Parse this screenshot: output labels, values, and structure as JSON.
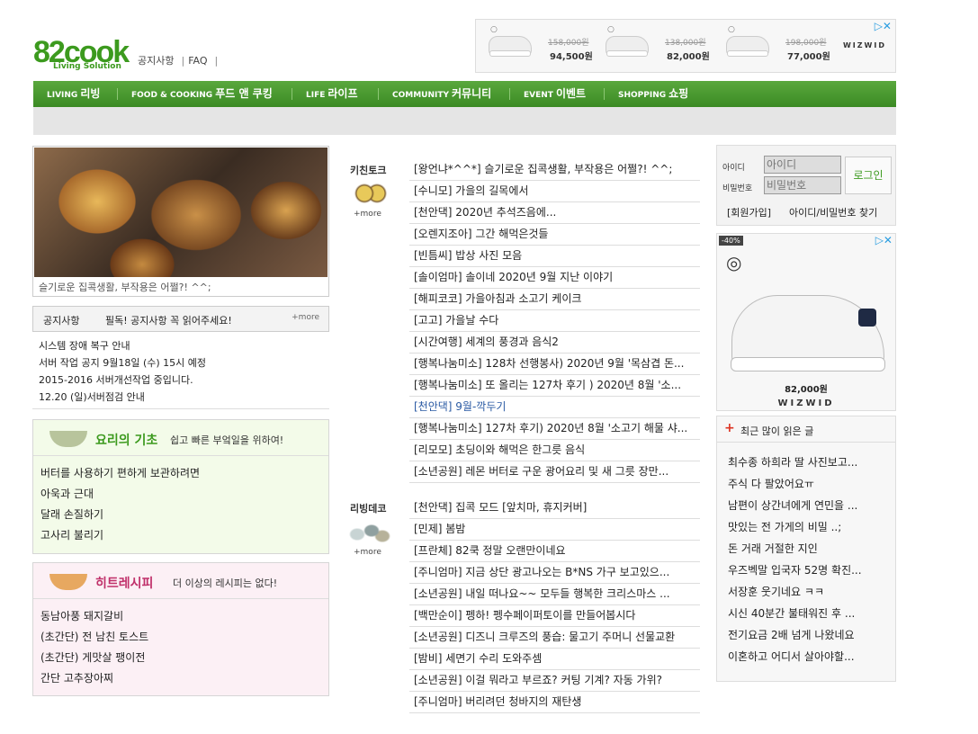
{
  "header": {
    "logo_main": "82cook",
    "logo_sub": "Living Solution",
    "links": [
      "공지사항",
      "FAQ"
    ]
  },
  "top_ad": {
    "items": [
      {
        "old_price": "158,000원",
        "new_price": "94,500원"
      },
      {
        "old_price": "138,000원",
        "new_price": "82,000원"
      },
      {
        "old_price": "198,000원",
        "new_price": "77,000원"
      }
    ],
    "brand": "WIZWID"
  },
  "nav": [
    {
      "en": "LIVING",
      "ko": "리빙"
    },
    {
      "en": "FOOD & COOKING",
      "ko": "푸드 앤 쿠킹"
    },
    {
      "en": "LIFE",
      "ko": "라이프"
    },
    {
      "en": "COMMUNITY",
      "ko": "커뮤니티"
    },
    {
      "en": "EVENT",
      "ko": "이벤트"
    },
    {
      "en": "SHOPPING",
      "ko": "쇼핑"
    }
  ],
  "feature": {
    "caption": "슬기로운 집콕생활, 부작용은 어쩔?! ^^;"
  },
  "notice": {
    "title": "공지사항",
    "message": "필독! 공지사항 꼭 읽어주세요!",
    "more": "+more",
    "items": [
      "시스템 장애 복구 안내",
      "서버 작업 공지 9월18일 (수) 15시 예정",
      "2015-2016 서버개선작업 중입니다.",
      "12.20 (일)서버점검 안내"
    ]
  },
  "basics": {
    "title": "요리의 기초",
    "subtitle": "쉽고 빠른 부엌일을 위하여!",
    "items": [
      "버터를 사용하기 편하게 보관하려면",
      "아욱과 근대",
      "달래 손질하기",
      "고사리 불리기"
    ],
    "color": "#3c9a1e"
  },
  "hits": {
    "title": "히트레시피",
    "subtitle": "더 이상의 레시피는 없다!",
    "items": [
      "동남아풍 돼지갈비",
      "(초간단) 전 남친 토스트",
      "(초간단) 게맛살 팽이전",
      "간단 고추장아찌"
    ],
    "color": "#c0306a"
  },
  "kitchen_talk": {
    "label": "키친토크",
    "more": "+more",
    "items": [
      "[왕언냐*^^*] 슬기로운 집콕생활, 부작용은 어쩔?! ^^;",
      "[수니모] 가을의 길목에서",
      "[천안댁] 2020년 추석즈음에...",
      "[오렌지조아] 그간 해먹은것들",
      "[빈틈씨] 밥상 사진 모음",
      "[솔이엄마] 솔이네 2020년 9월 지난 이야기",
      "[해피코코] 가을아침과 소고기 케이크",
      "[고고] 가을날 수다",
      "[시간여행] 세계의 풍경과 음식2",
      "[행복나눔미소] 128차 선행봉사) 2020년 9월 '목삼겹 돈...",
      "[행복나눔미소] 또 올리는 127차 후기 ) 2020년 8월 '소...",
      "[천안댁] 9월-깍두기",
      "[행복나눔미소] 127차 후기) 2020년 8월 '소고기 해물 샤...",
      "[리모모] 초딩이와 해먹은 한그릇 음식",
      "[소년공원] 레몬 버터로 구운 광어요리 및 새 그릇 장만..."
    ]
  },
  "living_deco": {
    "label": "리빙데코",
    "more": "+more",
    "items": [
      "[천안댁] 집콕 모드 [앞치마, 휴지커버]",
      "[민제] 봄밤",
      "[프란체] 82쿡 정말 오랜만이네요",
      "[주니엄마] 지금 상단 광고나오는 B*NS 가구 보고있으...",
      "[소년공원] 내일 떠나요~~ 모두들 행복한 크리스마스 ...",
      "[백만순이] 펭하! 펭수페이퍼토이를 만들어봅시다",
      "[소년공원] 디즈니 크루즈의 풍습: 물고기 주머니 선물교환",
      "[밤비] 세면기 수리 도와주셈",
      "[소년공원] 이걸 뭐라고 부르죠? 커팅 기계? 자동 가위?",
      "[주니엄마] 버리려던 청바지의 재탄생"
    ]
  },
  "login": {
    "id_label": "아이디",
    "pw_label": "비밀번호",
    "id_placeholder": "아이디",
    "pw_placeholder": "비밀번호",
    "button": "로그인",
    "join": "[회원가입]",
    "find": "아이디/비밀번호 찾기"
  },
  "side_ad": {
    "badge": "-40%",
    "price": "82,000원",
    "brand": "WIZWID"
  },
  "popular": {
    "title": "최근 많이 읽은 글",
    "items": [
      "최수종 하희라 딸 사진보고...",
      "주식 다 팔았어요ㅠ",
      "남편이 상간녀에게 연민을 ...",
      "맛있는 전 가게의 비밀 ..;",
      "돈 거래 거절한 지인",
      "우즈벡말 입국자 52명 확진...",
      "서장훈 웃기네요 ㅋㅋ",
      "시신 40분간 불태워진 후 ...",
      "전기요금 2배 넘게 나왔네요",
      "이혼하고 어디서 살아야할..."
    ]
  }
}
